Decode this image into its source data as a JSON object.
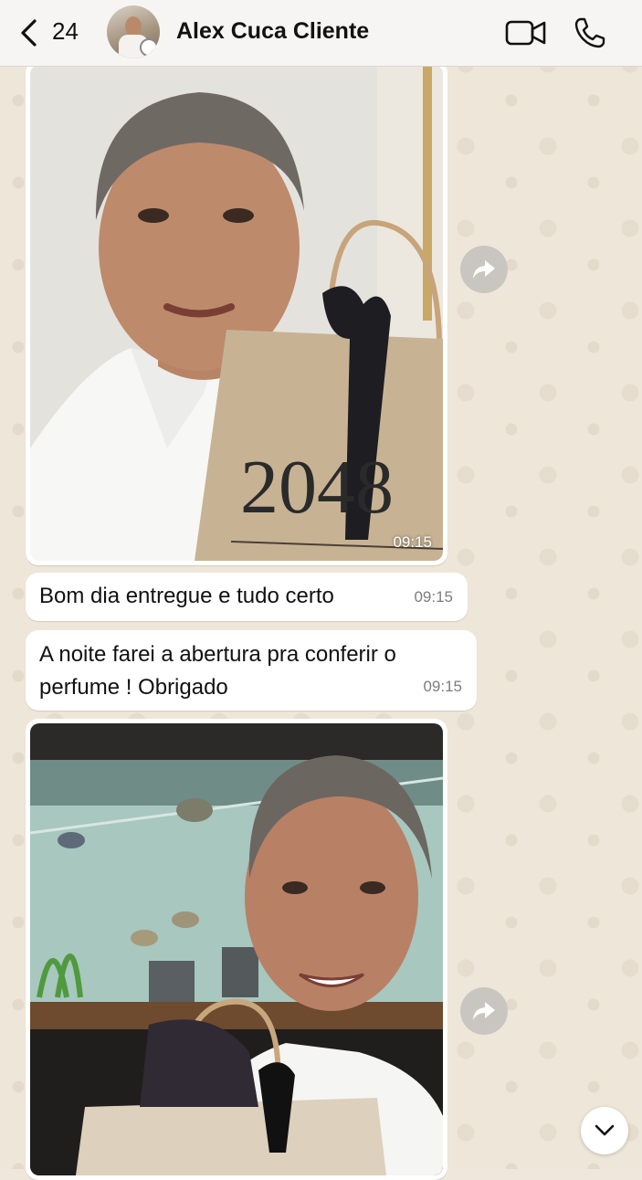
{
  "header": {
    "back_count": "24",
    "contact_name": "Alex Cuca Cliente"
  },
  "messages": [
    {
      "type": "image",
      "subject": "man holding gift bag",
      "bag_text": "2048",
      "time": "09:15"
    },
    {
      "type": "text",
      "text": "Bom dia entregue e tudo certo",
      "time": "09:15"
    },
    {
      "type": "text",
      "line1": "A noite farei a abertura pra conferir o",
      "line2": "perfume ! Obrigado",
      "time": "09:15"
    },
    {
      "type": "image",
      "subject": "man with gift bag in front of aquarium"
    }
  ],
  "icons": {
    "back": "chevron-left-icon",
    "video": "video-camera-icon",
    "phone": "phone-icon",
    "forward": "forward-arrow-icon",
    "scroll": "chevron-down-icon"
  },
  "colors": {
    "header_bg": "#f6f5f3",
    "chat_bg": "#efe6da",
    "bubble_bg": "#ffffff",
    "forward_btn": "#c9c6c1"
  }
}
